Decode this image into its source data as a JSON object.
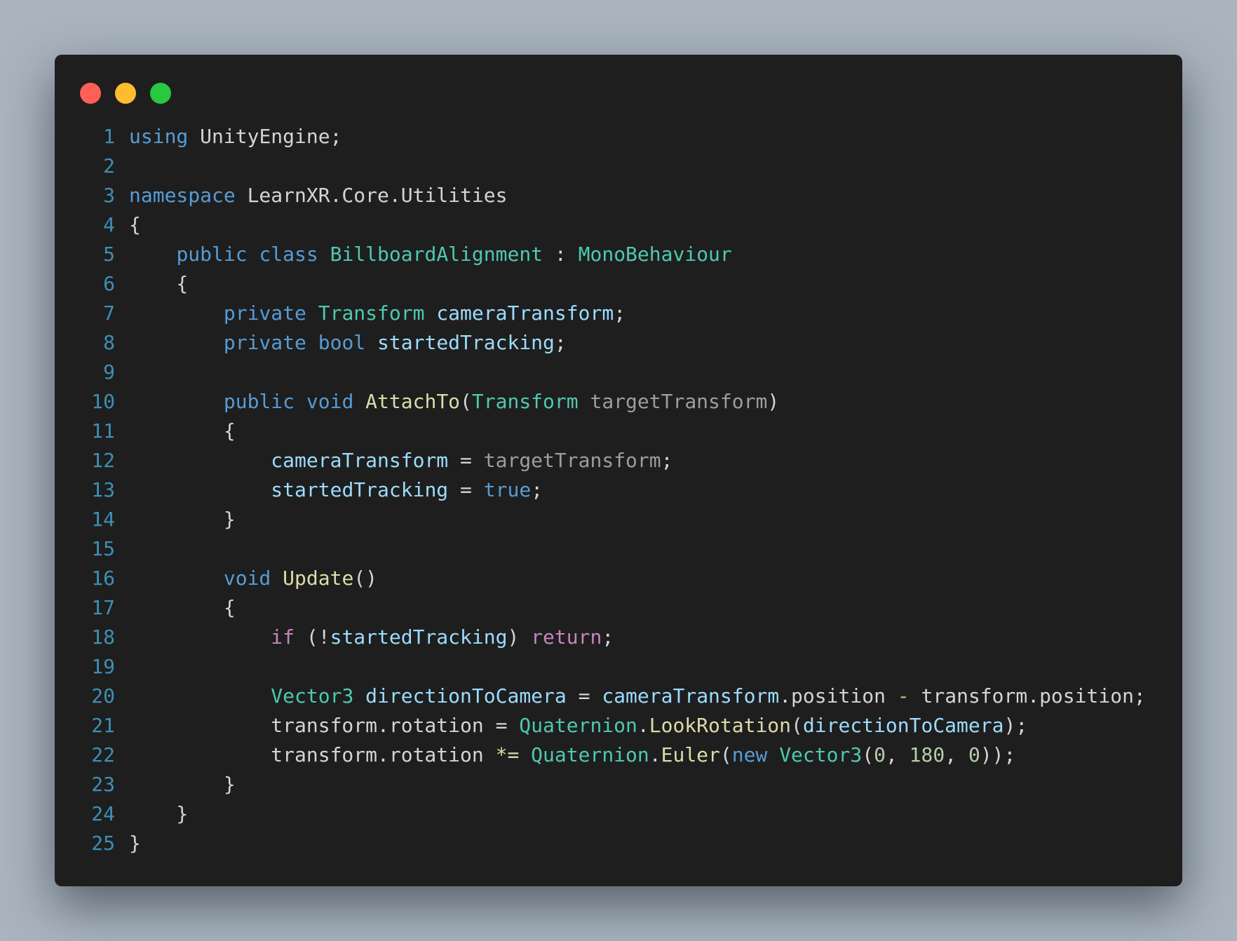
{
  "window": {
    "controls": [
      {
        "name": "close",
        "color": "#ff5f57"
      },
      {
        "name": "minimize",
        "color": "#febc2e"
      },
      {
        "name": "maximize",
        "color": "#28c840"
      }
    ]
  },
  "colors": {
    "background": "#a9b4be",
    "editor_background": "#1e1e1e",
    "line_number": "#3d8fb6"
  },
  "code": {
    "language": "csharp",
    "lines": [
      {
        "n": "1",
        "tokens": [
          {
            "t": "using",
            "c": "kw"
          },
          {
            "t": " UnityEngine;",
            "c": "plain"
          }
        ]
      },
      {
        "n": "2",
        "tokens": []
      },
      {
        "n": "3",
        "tokens": [
          {
            "t": "namespace",
            "c": "kw"
          },
          {
            "t": " LearnXR.Core.Utilities",
            "c": "plain"
          }
        ]
      },
      {
        "n": "4",
        "tokens": [
          {
            "t": "{",
            "c": "plain"
          }
        ]
      },
      {
        "n": "5",
        "tokens": [
          {
            "t": "    ",
            "c": "plain"
          },
          {
            "t": "public",
            "c": "kw"
          },
          {
            "t": " ",
            "c": "plain"
          },
          {
            "t": "class",
            "c": "kw"
          },
          {
            "t": " ",
            "c": "plain"
          },
          {
            "t": "BillboardAlignment",
            "c": "type"
          },
          {
            "t": " : ",
            "c": "plain"
          },
          {
            "t": "MonoBehaviour",
            "c": "type"
          }
        ]
      },
      {
        "n": "6",
        "tokens": [
          {
            "t": "    {",
            "c": "plain"
          }
        ]
      },
      {
        "n": "7",
        "tokens": [
          {
            "t": "        ",
            "c": "plain"
          },
          {
            "t": "private",
            "c": "kw"
          },
          {
            "t": " ",
            "c": "plain"
          },
          {
            "t": "Transform",
            "c": "type"
          },
          {
            "t": " ",
            "c": "plain"
          },
          {
            "t": "cameraTransform",
            "c": "var"
          },
          {
            "t": ";",
            "c": "plain"
          }
        ]
      },
      {
        "n": "8",
        "tokens": [
          {
            "t": "        ",
            "c": "plain"
          },
          {
            "t": "private",
            "c": "kw"
          },
          {
            "t": " ",
            "c": "plain"
          },
          {
            "t": "bool",
            "c": "kw"
          },
          {
            "t": " ",
            "c": "plain"
          },
          {
            "t": "startedTracking",
            "c": "var"
          },
          {
            "t": ";",
            "c": "plain"
          }
        ]
      },
      {
        "n": "9",
        "tokens": []
      },
      {
        "n": "10",
        "tokens": [
          {
            "t": "        ",
            "c": "plain"
          },
          {
            "t": "public",
            "c": "kw"
          },
          {
            "t": " ",
            "c": "plain"
          },
          {
            "t": "void",
            "c": "kw"
          },
          {
            "t": " ",
            "c": "plain"
          },
          {
            "t": "AttachTo",
            "c": "fn"
          },
          {
            "t": "(",
            "c": "plain"
          },
          {
            "t": "Transform",
            "c": "type"
          },
          {
            "t": " targetTransform",
            "c": "param"
          },
          {
            "t": ")",
            "c": "plain"
          }
        ]
      },
      {
        "n": "11",
        "tokens": [
          {
            "t": "        {",
            "c": "plain"
          }
        ]
      },
      {
        "n": "12",
        "tokens": [
          {
            "t": "            ",
            "c": "plain"
          },
          {
            "t": "cameraTransform",
            "c": "var"
          },
          {
            "t": " = ",
            "c": "plain"
          },
          {
            "t": "targetTransform",
            "c": "param"
          },
          {
            "t": ";",
            "c": "plain"
          }
        ]
      },
      {
        "n": "13",
        "tokens": [
          {
            "t": "            ",
            "c": "plain"
          },
          {
            "t": "startedTracking",
            "c": "var"
          },
          {
            "t": " = ",
            "c": "plain"
          },
          {
            "t": "true",
            "c": "kw"
          },
          {
            "t": ";",
            "c": "plain"
          }
        ]
      },
      {
        "n": "14",
        "tokens": [
          {
            "t": "        }",
            "c": "plain"
          }
        ]
      },
      {
        "n": "15",
        "tokens": []
      },
      {
        "n": "16",
        "tokens": [
          {
            "t": "        ",
            "c": "plain"
          },
          {
            "t": "void",
            "c": "kw"
          },
          {
            "t": " ",
            "c": "plain"
          },
          {
            "t": "Update",
            "c": "fn"
          },
          {
            "t": "()",
            "c": "plain"
          }
        ]
      },
      {
        "n": "17",
        "tokens": [
          {
            "t": "        {",
            "c": "plain"
          }
        ]
      },
      {
        "n": "18",
        "tokens": [
          {
            "t": "            ",
            "c": "plain"
          },
          {
            "t": "if",
            "c": "ctrl"
          },
          {
            "t": " (!",
            "c": "plain"
          },
          {
            "t": "startedTracking",
            "c": "var"
          },
          {
            "t": ") ",
            "c": "plain"
          },
          {
            "t": "return",
            "c": "ctrl"
          },
          {
            "t": ";",
            "c": "plain"
          }
        ]
      },
      {
        "n": "19",
        "tokens": []
      },
      {
        "n": "20",
        "tokens": [
          {
            "t": "            ",
            "c": "plain"
          },
          {
            "t": "Vector3",
            "c": "type"
          },
          {
            "t": " ",
            "c": "plain"
          },
          {
            "t": "directionToCamera",
            "c": "var"
          },
          {
            "t": " = ",
            "c": "plain"
          },
          {
            "t": "cameraTransform",
            "c": "var"
          },
          {
            "t": ".position ",
            "c": "plain"
          },
          {
            "t": "-",
            "c": "hl"
          },
          {
            "t": " transform.position;",
            "c": "plain"
          }
        ]
      },
      {
        "n": "21",
        "tokens": [
          {
            "t": "            transform.rotation = ",
            "c": "plain"
          },
          {
            "t": "Quaternion",
            "c": "type"
          },
          {
            "t": ".",
            "c": "plain"
          },
          {
            "t": "LookRotation",
            "c": "fn"
          },
          {
            "t": "(",
            "c": "plain"
          },
          {
            "t": "directionToCamera",
            "c": "var"
          },
          {
            "t": ");",
            "c": "plain"
          }
        ]
      },
      {
        "n": "22",
        "tokens": [
          {
            "t": "            transform.rotation ",
            "c": "plain"
          },
          {
            "t": "*=",
            "c": "fn"
          },
          {
            "t": " ",
            "c": "plain"
          },
          {
            "t": "Quaternion",
            "c": "type"
          },
          {
            "t": ".",
            "c": "plain"
          },
          {
            "t": "Euler",
            "c": "fn"
          },
          {
            "t": "(",
            "c": "plain"
          },
          {
            "t": "new",
            "c": "kw"
          },
          {
            "t": " ",
            "c": "plain"
          },
          {
            "t": "Vector3",
            "c": "type"
          },
          {
            "t": "(",
            "c": "plain"
          },
          {
            "t": "0",
            "c": "num"
          },
          {
            "t": ", ",
            "c": "plain"
          },
          {
            "t": "180",
            "c": "num"
          },
          {
            "t": ", ",
            "c": "plain"
          },
          {
            "t": "0",
            "c": "num"
          },
          {
            "t": "));",
            "c": "plain"
          }
        ]
      },
      {
        "n": "23",
        "tokens": [
          {
            "t": "        }",
            "c": "plain"
          }
        ]
      },
      {
        "n": "24",
        "tokens": [
          {
            "t": "    }",
            "c": "plain"
          }
        ]
      },
      {
        "n": "25",
        "tokens": [
          {
            "t": "}",
            "c": "plain"
          }
        ]
      }
    ]
  }
}
